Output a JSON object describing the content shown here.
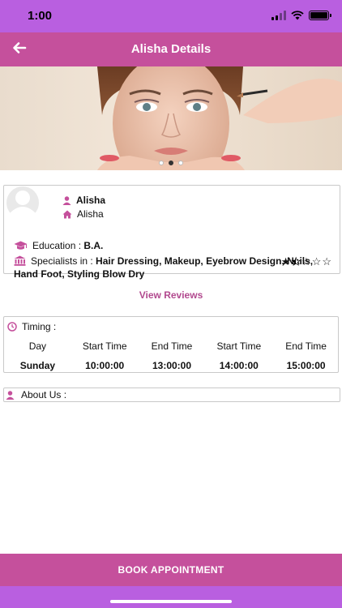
{
  "status_bar": {
    "time": "1:00"
  },
  "header": {
    "title": "Alisha Details"
  },
  "banner": {
    "slide_count": 3,
    "active_index": 1
  },
  "profile": {
    "name": "Alisha",
    "sub_name": "Alisha",
    "education_label": "Education : ",
    "education_value": "B.A.",
    "specialists_label": "Specialists in : ",
    "specialists_value": "Hair Dressing, Makeup, Eyebrow Design, Nails, Hand Foot, Styling Blow Dry",
    "rating": 1.5
  },
  "view_reviews": "View Reviews",
  "timing": {
    "label": "Timing :",
    "headers": [
      "Day",
      "Start Time",
      "End Time",
      "Start Time",
      "End Time"
    ],
    "values": [
      "Sunday",
      "10:00:00",
      "13:00:00",
      "14:00:00",
      "15:00:00"
    ]
  },
  "about": {
    "label": "About Us :"
  },
  "book_button": "BOOK APPOINTMENT",
  "colors": {
    "accent": "#c5509c",
    "status_bar": "#b95fe0"
  }
}
